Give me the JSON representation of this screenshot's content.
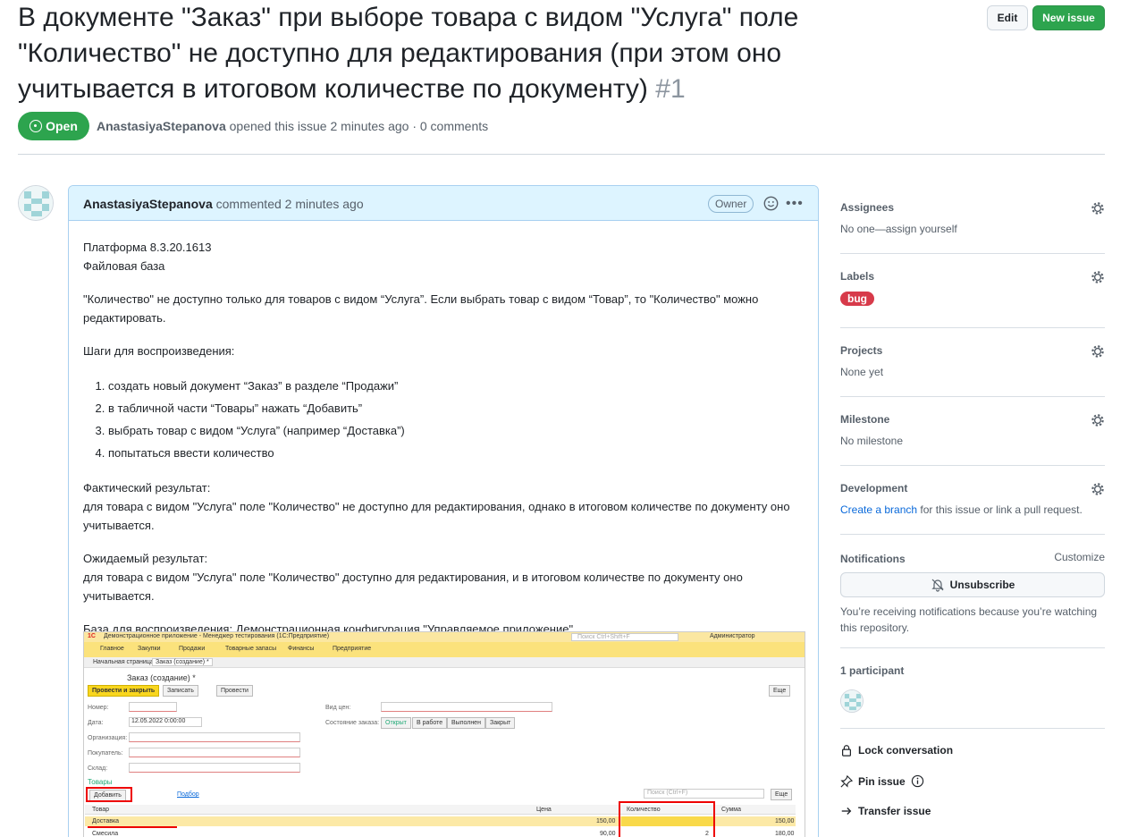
{
  "issue": {
    "title": "В документе \"Заказ\" при выборе товара с видом \"Услуга\" поле \"Количество\" не доступно для редактирования (при этом оно учитывается в итоговом количестве по документу)",
    "number": "#1",
    "state": "Open",
    "author": "AnastasiyaStepanova",
    "opened_text": "opened this issue 2 minutes ago · 0 comments"
  },
  "header": {
    "edit_label": "Edit",
    "new_issue_label": "New issue"
  },
  "comment": {
    "author": "AnastasiyaStepanova",
    "time": "commented 2 minutes ago",
    "badge": "Owner",
    "platform": "Платформа 8.3.20.1613",
    "base": "Файловая база",
    "intro": "\"Количество\" не доступно только для товаров с видом “Услуга”. Если выбрать товар с видом “Товар”, то \"Количество\" можно редактировать.",
    "steps_title": "Шаги для воспроизведения:",
    "steps": [
      "создать новый документ “Заказ” в разделе “Продажи”",
      "в табличной части “Товары” нажать “Добавить”",
      "выбрать товар с видом “Услуга” (например “Доставка”)",
      "попытаться ввести количество"
    ],
    "actual_title": "Фактический результат:",
    "actual_text": "для товара с видом \"Услуга\" поле \"Количество\" не доступно для редактирования, однако в итоговом количестве по документу оно учитывается.",
    "expected_title": "Ожидаемый результат:",
    "expected_text": "для товара с видом \"Услуга\" поле \"Количество\" доступно для редактирования, и в итоговом количестве по документу оно учитывается.",
    "config": "База для воспроизведения: Демонстрационная конфигурация \"Управляемое приложение\""
  },
  "screenshot": {
    "window_title": "Демонстрационное приложение - Менеджер тестирования (1С:Предприятие)",
    "search_placeholder": "Поиск Ctrl+Shift+F",
    "user": "Администратор",
    "menu": [
      "Главное",
      "Закупки",
      "Продажи",
      "Товарные запасы",
      "Финансы",
      "Предприятие"
    ],
    "tabs": [
      "Начальная страница",
      "Заказ (создание) *"
    ],
    "doc_title": "Заказ (создание) *",
    "buttons": {
      "post_close": "Провести и закрыть",
      "write": "Записать",
      "post": "Провести",
      "more": "Еще"
    },
    "labels": {
      "number": "Номер:",
      "date": "Дата:",
      "org": "Организация:",
      "buyer": "Покупатель:",
      "warehouse": "Склад:",
      "price_type": "Вид цен:",
      "order_state": "Состояние заказа:"
    },
    "date_value": "12.05.2022  0:00:00",
    "states": [
      "Открыт",
      "В работе",
      "Выполнен",
      "Закрыт"
    ],
    "goods_title": "Товары",
    "add": "Добавить",
    "selection": "Подбор",
    "table_search": "Поиск (Ctrl+F)",
    "columns": [
      "Товар",
      "Цена",
      "Количество",
      "Сумма"
    ],
    "rows": [
      {
        "item": "Доставка",
        "price": "150,00",
        "qty": "",
        "sum": "150,00"
      },
      {
        "item": "Смесила",
        "price": "90,00",
        "qty": "2",
        "sum": "180,00"
      }
    ]
  },
  "sidebar": {
    "assignees": {
      "title": "Assignees",
      "value": "No one—assign yourself"
    },
    "labels": {
      "title": "Labels",
      "value": "bug"
    },
    "projects": {
      "title": "Projects",
      "value": "None yet"
    },
    "milestone": {
      "title": "Milestone",
      "value": "No milestone"
    },
    "development": {
      "title": "Development",
      "link": "Create a branch",
      "rest": " for this issue or link a pull request."
    },
    "notifications": {
      "title": "Notifications",
      "customize": "Customize",
      "unsubscribe": "Unsubscribe",
      "note": "You’re receiving notifications because you’re watching this repository."
    },
    "participants": "1 participant",
    "actions": [
      "Lock conversation",
      "Pin issue",
      "Transfer issue"
    ]
  },
  "colors": {
    "open_green": "#2da44e",
    "bug_red": "#d73a4a",
    "link_blue": "#0969da",
    "comment_header": "#ddf4ff"
  },
  "icons": [
    "gear-icon",
    "bell-slash-icon",
    "lock-icon",
    "pin-icon",
    "info-icon",
    "arrow-right-icon",
    "smiley-icon",
    "kebab-icon"
  ]
}
